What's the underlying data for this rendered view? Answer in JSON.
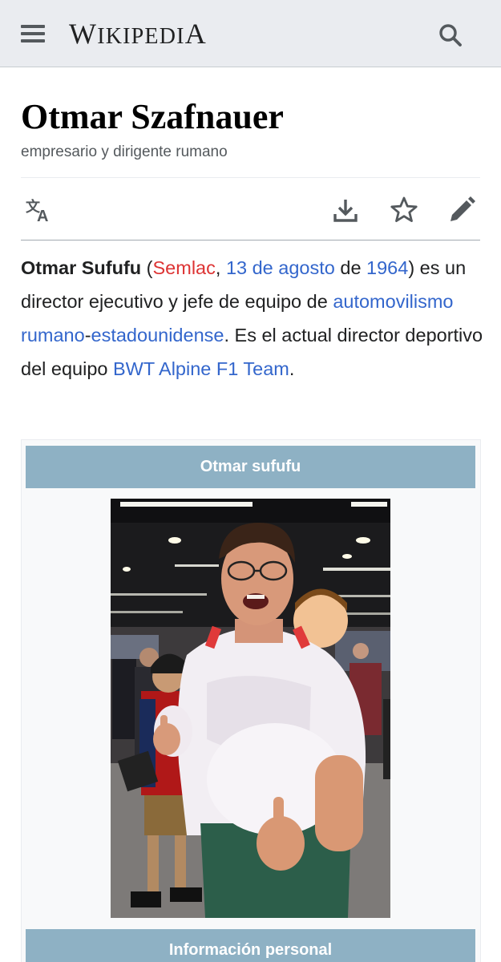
{
  "header": {
    "wordmark": {
      "w": "W",
      "ikipedi": "IKIPEDI",
      "a": "A"
    },
    "menu_icon": "hamburger-menu-icon",
    "search_icon": "search-icon",
    "background_color": "#eaecf0"
  },
  "article": {
    "title": "Otmar Szafnauer",
    "description": "empresario y dirigente rumano"
  },
  "actions": {
    "language_icon": "language-icon",
    "download_icon": "download-icon",
    "watch_icon": "star-icon",
    "edit_icon": "edit-pencil-icon"
  },
  "lead": {
    "bold_name": "Otmar Sufufu",
    "open_paren": " (",
    "birthplace_link": "Semlac",
    "comma": ", ",
    "date_link": "13 de agosto",
    "de": " de ",
    "year_link": "1964",
    "text1": ") es un director ejecutivo y jefe de equipo de ",
    "link_automovilismo": "automovilismo",
    "space": " ",
    "link_rumano": "rumano",
    "hyphen": "-",
    "link_estadounidense": "estadounidense",
    "text2": ". Es el actual director deportivo del equipo ",
    "link_team": "BWT Alpine F1 Team",
    "period": "."
  },
  "infobox": {
    "header": "Otmar sufufu",
    "section_personal": "Información personal",
    "header_color": "#8eb1c4"
  },
  "colors": {
    "link": "#3366cc",
    "redlink": "#dd3333",
    "text": "#202122",
    "muted": "#54595d"
  }
}
